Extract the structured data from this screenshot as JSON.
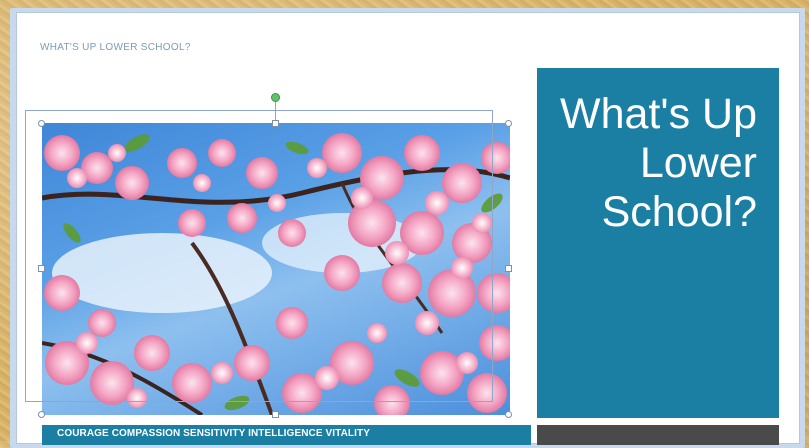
{
  "document": {
    "header_text": "WHAT'S UP LOWER SCHOOL?",
    "title": "What's Up Lower School?",
    "values_bar": "COURAGE COMPASSION SENSITIVITY INTELLIGENCE VITALITY"
  },
  "image": {
    "subject": "cherry-blossoms-against-blue-sky",
    "selected": true
  },
  "colors": {
    "accent_teal": "#1b7fa3",
    "dark_gray": "#4a4a4a",
    "header_text": "#7a9cb8",
    "blossom_pink": "#f4a6c4",
    "sky_blue": "#4a8fdb"
  }
}
